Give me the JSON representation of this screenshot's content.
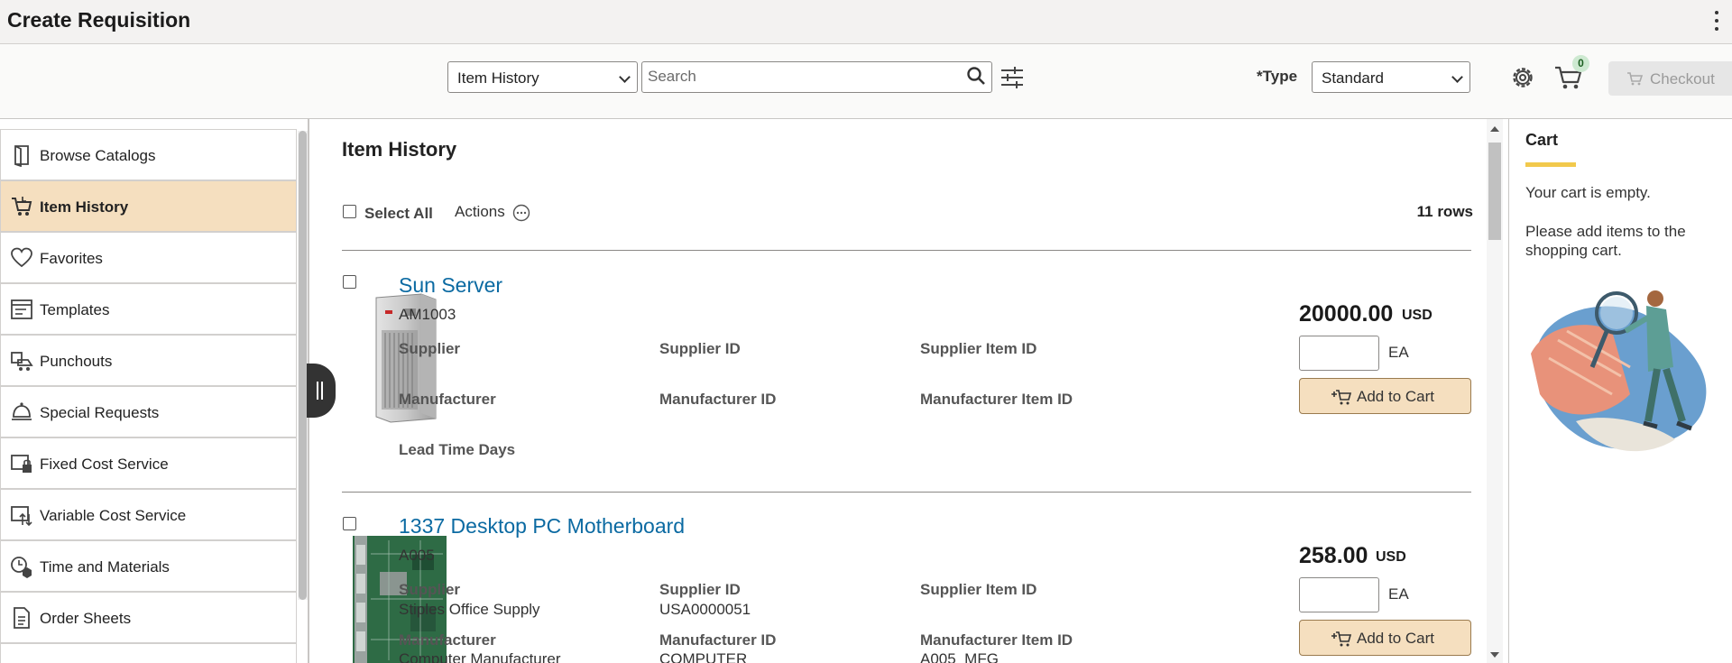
{
  "app": {
    "title": "Create Requisition"
  },
  "toolbar": {
    "view_select": "Item History",
    "search_placeholder": "Search",
    "type_label": "*Type",
    "type_select": "Standard",
    "cart_count": "0",
    "checkout_label": "Checkout"
  },
  "nav": {
    "items": [
      {
        "label": "Browse Catalogs",
        "icon": "catalog-icon"
      },
      {
        "label": "Item History",
        "icon": "cart-history-icon",
        "active": true
      },
      {
        "label": "Favorites",
        "icon": "heart-icon"
      },
      {
        "label": "Templates",
        "icon": "template-icon"
      },
      {
        "label": "Punchouts",
        "icon": "punchout-icon"
      },
      {
        "label": "Special Requests",
        "icon": "bell-icon"
      },
      {
        "label": "Fixed Cost Service",
        "icon": "fixed-cost-icon"
      },
      {
        "label": "Variable Cost Service",
        "icon": "variable-cost-icon"
      },
      {
        "label": "Time and Materials",
        "icon": "time-materials-icon"
      },
      {
        "label": "Order Sheets",
        "icon": "order-sheet-icon"
      }
    ]
  },
  "main": {
    "title": "Item History",
    "select_all": "Select All",
    "actions": "Actions",
    "rows_count": "11 rows",
    "labels": {
      "supplier": "Supplier",
      "supplier_id": "Supplier ID",
      "supplier_item_id": "Supplier Item ID",
      "manufacturer": "Manufacturer",
      "manufacturer_id": "Manufacturer ID",
      "manufacturer_item_id": "Manufacturer Item ID",
      "lead_time_days": "Lead Time Days",
      "uom": "EA",
      "add_to_cart": "Add to Cart"
    },
    "items": [
      {
        "name": "Sun Server",
        "id": "AM1003",
        "price": "20000.00",
        "currency": "USD",
        "supplier": "",
        "supplier_id": "",
        "supplier_item_id": "",
        "manufacturer": "",
        "manufacturer_id": "",
        "manufacturer_item_id": ""
      },
      {
        "name": "1337 Desktop PC Motherboard",
        "id": "A005",
        "price": "258.00",
        "currency": "USD",
        "supplier": "Stiples Office Supply",
        "supplier_id": "USA0000051",
        "supplier_item_id": "",
        "manufacturer": "Computer Manufacturer",
        "manufacturer_id": "COMPUTER",
        "manufacturer_item_id": "A005_MFG"
      }
    ]
  },
  "cart": {
    "title": "Cart",
    "empty_msg": "Your cart is empty.",
    "hint": "Please add items to the shopping cart."
  },
  "colors": {
    "accent": "#f5dfbf",
    "link": "#0b6aa2",
    "cart_underline": "#f2c94c",
    "badge": "#cde9d1"
  }
}
